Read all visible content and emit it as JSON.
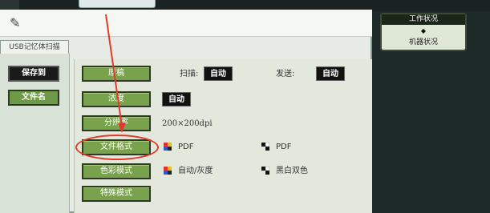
{
  "tab_label": "USB记忆体扫描",
  "left_menu": {
    "save_to": "保存到",
    "file_name": "文件名"
  },
  "rows": {
    "original_btn": "原稿",
    "scan_label": "扫描:",
    "scan_value": "自动",
    "send_label": "发送:",
    "send_value": "自动",
    "density_btn": "浓度",
    "density_value": "自动",
    "resolution_btn": "分辨率",
    "resolution_value": "200×200dpi",
    "file_format_btn": "文件格式",
    "file_format_color": "PDF",
    "file_format_bw": "PDF",
    "color_mode_btn": "色彩模式",
    "color_mode_color": "自动/灰度",
    "color_mode_bw": "黑白双色",
    "special_mode_btn": "特殊模式"
  },
  "right_panel": {
    "job_status": "工作状况",
    "arrows": "◆",
    "machine_status": "机器状况"
  },
  "colors": {
    "button_green": "#78a34c",
    "annotation_red": "#e23a2a"
  }
}
